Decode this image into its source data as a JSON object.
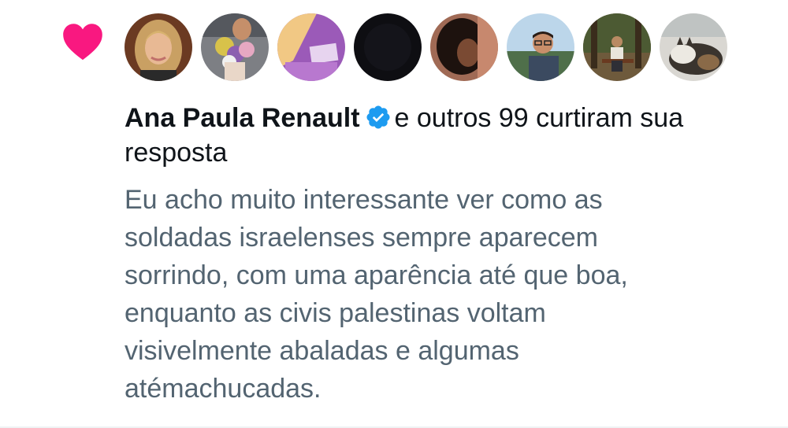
{
  "notification": {
    "type_icon": "heart-icon",
    "accent_color": "#f91880",
    "avatars": [
      {
        "name": "avatar-1"
      },
      {
        "name": "avatar-2"
      },
      {
        "name": "avatar-3"
      },
      {
        "name": "avatar-4"
      },
      {
        "name": "avatar-5"
      },
      {
        "name": "avatar-6"
      },
      {
        "name": "avatar-7"
      },
      {
        "name": "avatar-8"
      }
    ],
    "user_name": "Ana Paula Renault",
    "verified_icon": "verified-badge-icon",
    "verified_color": "#1d9bf0",
    "action_text": "e outros 99 curtiram sua resposta",
    "reply_text": "Eu acho muito interessante ver como as\nsoldadas israelenses sempre aparecem\nsorrindo, com uma aparência até que boa,\nenquanto as civis palestinas voltam\nvisivelmente abaladas e algumas\natémachucadas."
  }
}
